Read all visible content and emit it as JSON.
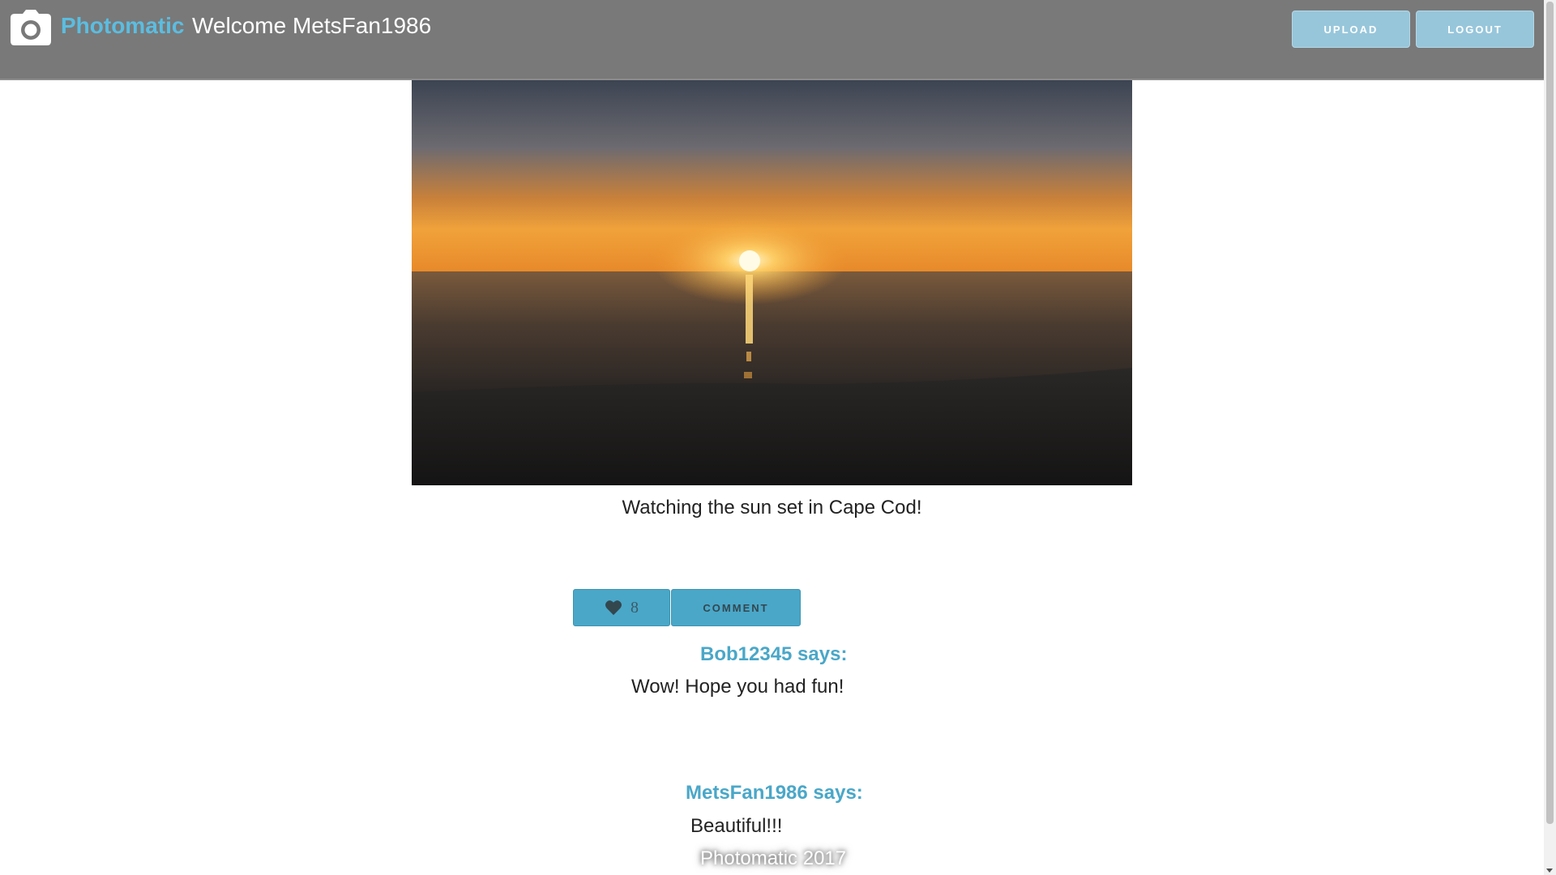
{
  "header": {
    "brand": "Photomatic",
    "welcome": "Welcome MetsFan1986",
    "upload_label": "UPLOAD",
    "logout_label": "LOGOUT",
    "logo_icon": "camera-icon",
    "brand_color": "#5bbde0",
    "bar_color": "#797979"
  },
  "post": {
    "caption": "Watching the sun set in Cape Cod!",
    "like_icon": "heart-icon",
    "like_count": "8",
    "comment_label": "COMMENT",
    "accent_color": "#4aa7c8"
  },
  "comments": [
    {
      "author": "Bob12345 says:",
      "text": "Wow! Hope you had fun!"
    },
    {
      "author": "MetsFan1986 says:",
      "text": "Beautiful!!!"
    }
  ],
  "footer": {
    "text": "Photomatic 2017"
  }
}
